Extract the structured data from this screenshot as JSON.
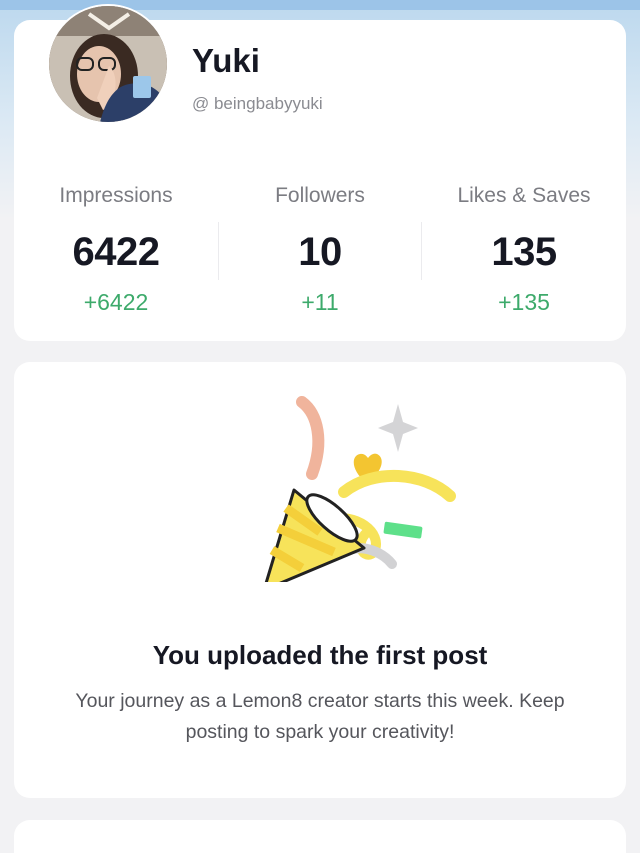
{
  "profile": {
    "name": "Yuki",
    "handle": "@ beingbabyyuki"
  },
  "stats": [
    {
      "label": "Impressions",
      "value": "6422",
      "delta": "+6422"
    },
    {
      "label": "Followers",
      "value": "10",
      "delta": "+11"
    },
    {
      "label": "Likes & Saves",
      "value": "135",
      "delta": "+135"
    }
  ],
  "milestone": {
    "title": "You uploaded the first post",
    "description": "Your journey as a Lemon8 creator starts this week. Keep posting to spark your creativity!",
    "icon": "party-popper-icon"
  },
  "colors": {
    "accent_green": "#3daa6b",
    "popper_yellow": "#f7e35a",
    "streamer_pink": "#f0b49c",
    "streamer_green": "#5ee08a"
  }
}
